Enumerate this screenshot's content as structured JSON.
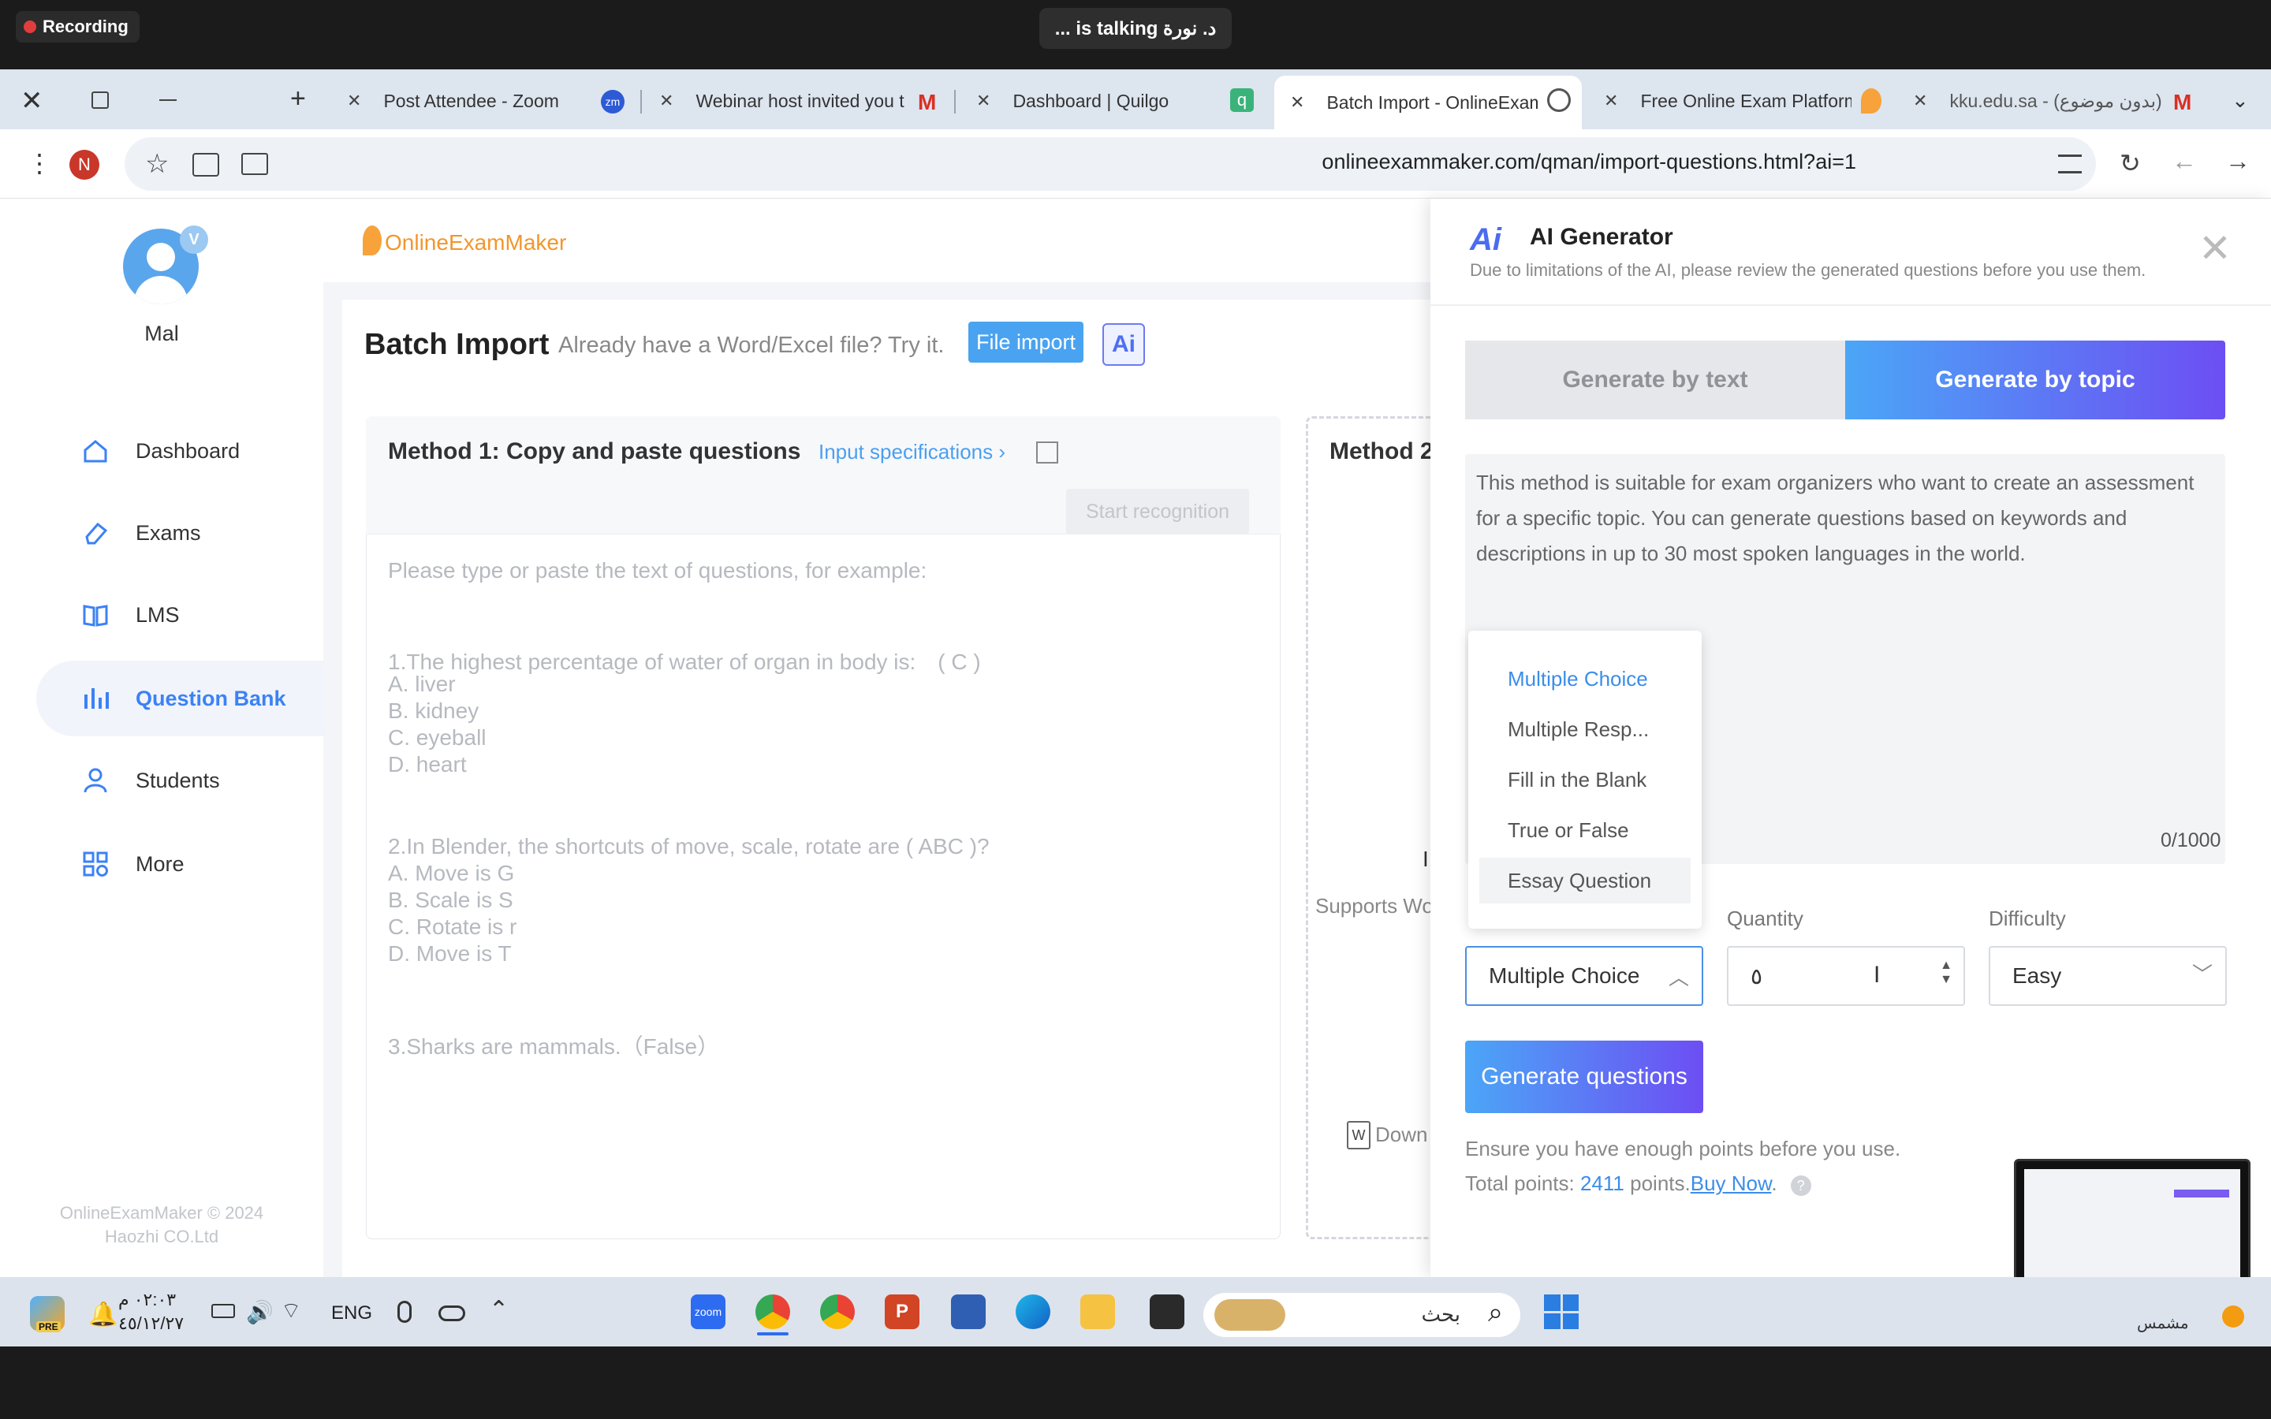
{
  "zoom": {
    "recording": "Recording",
    "talking": "د. نورة is talking ..."
  },
  "tabs": [
    {
      "title": "Post Attendee - Zoom"
    },
    {
      "title": "Webinar host invited you t"
    },
    {
      "title": "Dashboard | Quilgo"
    },
    {
      "title": "Batch Import - OnlineExam"
    },
    {
      "title": "Free Online Exam Platform"
    },
    {
      "title": "kku.edu.sa - (بدون موضوع)"
    }
  ],
  "browser": {
    "url": "onlineexammaker.com/qman/import-questions.html?ai=1",
    "profile_initial": "N"
  },
  "user": {
    "name": "Mal",
    "badge": "V"
  },
  "sidebar": {
    "items": [
      {
        "label": "Dashboard"
      },
      {
        "label": "Exams"
      },
      {
        "label": "LMS"
      },
      {
        "label": "Question Bank"
      },
      {
        "label": "Students"
      },
      {
        "label": "More"
      }
    ],
    "footer_line1": "OnlineExamMaker © 2024",
    "footer_line2": "Haozhi CO.Ltd"
  },
  "header": {
    "brand": "OnlineExamMaker"
  },
  "batch": {
    "title": "Batch Import",
    "subtitle": "Already have a Word/Excel file? Try it.",
    "file_import": "File import",
    "ai_badge": "Ai",
    "method1_title": "Method 1: Copy and paste questions",
    "input_spec": "Input specifications",
    "start_recognition": "Start recognition",
    "method2_title": "Method 2",
    "supports": "Supports Wo",
    "download": "Down",
    "method2_frag": "I",
    "placeholder_lines": [
      "Please type or paste the text of questions, for example:",
      "1.The highest percentage of water of organ in body is:　( C )",
      "A. liver",
      "B. kidney",
      "C. eyeball",
      "D. heart",
      "2.In Blender, the shortcuts of move, scale, rotate are ( ABC )?",
      "A. Move is G",
      "B. Scale is S",
      "C. Rotate is r",
      "D. Move is T",
      "3.Sharks are mammals.（False）"
    ]
  },
  "ai": {
    "title": "AI Generator",
    "logo": "Ai",
    "note": "Due to limitations of the AI, please review the generated questions before you use them.",
    "tab_text": "Generate by text",
    "tab_topic": "Generate by topic",
    "description": "This method is suitable for exam organizers who want to create an assessment for a specific topic. You can generate questions based on keywords and descriptions in up to 30 most spoken languages in the world.",
    "counter": "0/1000",
    "type_options": [
      "Multiple Choice",
      "Multiple Resp...",
      "Fill in the Blank",
      "True or False",
      "Essay Question"
    ],
    "type_value": "Multiple Choice",
    "quantity_label": "Quantity",
    "quantity_value": "٥",
    "difficulty_label": "Difficulty",
    "difficulty_value": "Easy",
    "generate": "Generate questions",
    "ensure": "Ensure you have enough points before you use.",
    "total_prefix": "Total points:",
    "total_points": "2411",
    "points_suffix": "points.",
    "buy_now": "Buy Now",
    "help": "?",
    "accent": "#3b82f6"
  },
  "taskbar": {
    "time": "٠٢:٠٣ م",
    "date": "٤٥/١٢/٢٧",
    "lang": "ENG",
    "search": "بحث",
    "weather": "مشمس",
    "pre": "PRE"
  }
}
